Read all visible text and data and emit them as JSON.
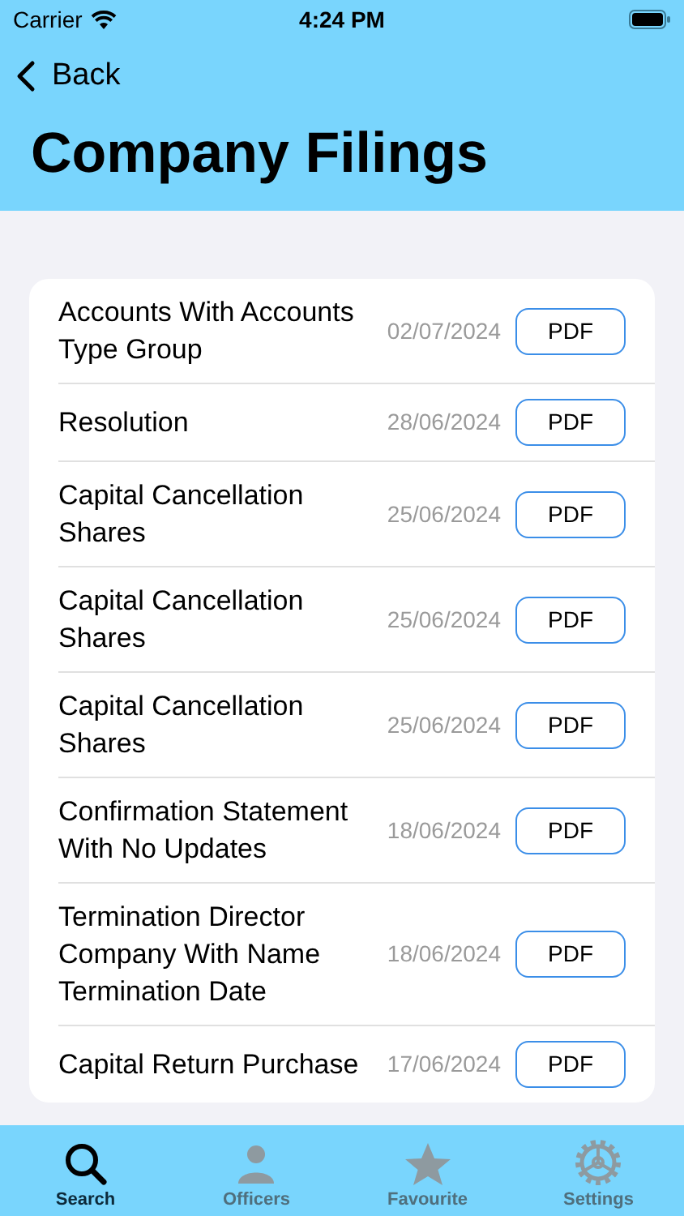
{
  "status_bar": {
    "carrier": "Carrier",
    "time": "4:24 PM"
  },
  "nav": {
    "back": "Back",
    "title": "Company Filings"
  },
  "filings": [
    {
      "title": "Accounts With Accounts Type Group",
      "date": "02/07/2024",
      "action": "PDF"
    },
    {
      "title": "Resolution",
      "date": "28/06/2024",
      "action": "PDF"
    },
    {
      "title": "Capital Cancellation Shares",
      "date": "25/06/2024",
      "action": "PDF"
    },
    {
      "title": "Capital Cancellation Shares",
      "date": "25/06/2024",
      "action": "PDF"
    },
    {
      "title": "Capital Cancellation Shares",
      "date": "25/06/2024",
      "action": "PDF"
    },
    {
      "title": "Confirmation Statement With No Updates",
      "date": "18/06/2024",
      "action": "PDF"
    },
    {
      "title": "Termination Director Company With Name Termination Date",
      "date": "18/06/2024",
      "action": "PDF"
    },
    {
      "title": "Capital Return Purchase",
      "date": "17/06/2024",
      "action": "PDF"
    }
  ],
  "tab_bar": [
    {
      "kind": "search",
      "label": "Search",
      "selected": true
    },
    {
      "kind": "person",
      "label": "Officers",
      "selected": false
    },
    {
      "kind": "star",
      "label": "Favourite",
      "selected": false
    },
    {
      "kind": "gear",
      "label": "Settings",
      "selected": false
    }
  ]
}
